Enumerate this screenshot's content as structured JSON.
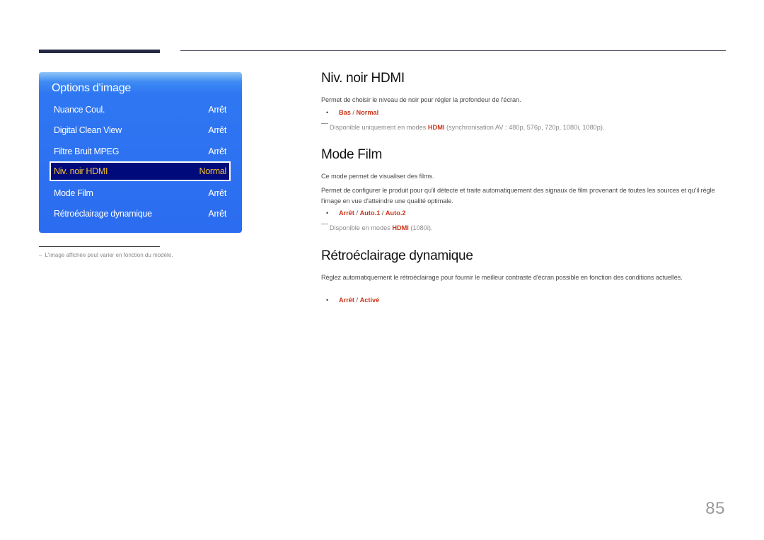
{
  "menu": {
    "title": "Options d'image",
    "items": [
      {
        "label": "Nuance Coul.",
        "value": "Arrêt",
        "selected": false
      },
      {
        "label": "Digital Clean View",
        "value": "Arrêt",
        "selected": false
      },
      {
        "label": "Filtre Bruit MPEG",
        "value": "Arrêt",
        "selected": false
      },
      {
        "label": "Niv. noir HDMI",
        "value": "Normal",
        "selected": true
      },
      {
        "label": "Mode Film",
        "value": "Arrêt",
        "selected": false
      },
      {
        "label": "Rétroéclairage dynamique",
        "value": "Arrêt",
        "selected": false
      }
    ]
  },
  "footnote": {
    "dash": "–",
    "text": "L'image affichée peut varier en fonction du modèle."
  },
  "sections": {
    "hdmi_black": {
      "title": "Niv. noir HDMI",
      "description": "Permet de choisir le niveau de noir pour régler la profondeur de l'écran.",
      "options": [
        "Bas",
        "Normal"
      ],
      "note": {
        "before": "Disponible uniquement en modes ",
        "highlight": "HDMI",
        "after": " (synchronisation AV : 480p, 576p, 720p, 1080i, 1080p)."
      }
    },
    "film_mode": {
      "title": "Mode Film",
      "description1": "Ce mode permet de visualiser des films.",
      "description2": "Permet de configurer le produit pour qu'il détecte et traite automatiquement des signaux de film provenant de toutes les sources et qu'il règle l'image en vue d'atteindre une qualité optimale.",
      "options": [
        "Arrêt",
        "Auto.1",
        "Auto.2"
      ],
      "note": {
        "before": "Disponible en modes ",
        "highlight": "HDMI",
        "after": " (1080i)."
      }
    },
    "dynamic_backlight": {
      "title": "Rétroéclairage dynamique",
      "description": "Réglez automatiquement le rétroéclairage pour fournir le meilleur contraste d'écran possible en fonction des conditions actuelles.",
      "options": [
        "Arrêt",
        "Activé"
      ]
    }
  },
  "separator": " / ",
  "bullet": "•",
  "page_number": "85",
  "colors": {
    "accent": "#c9351b",
    "menu_blue": "#2b6cf0",
    "menu_selected_bg": "#000a7a",
    "menu_selected_text": "#f5c230",
    "header_bar": "#262a44"
  }
}
